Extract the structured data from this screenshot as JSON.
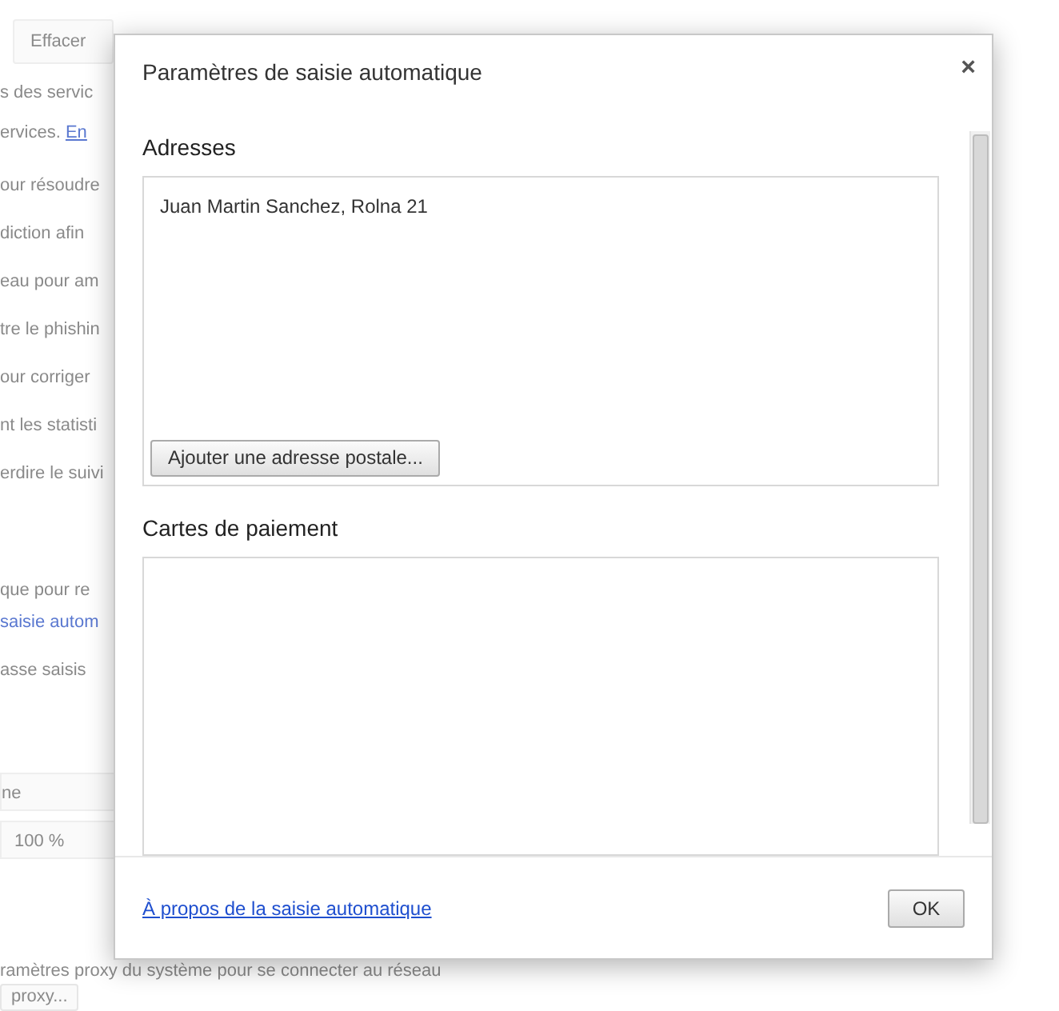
{
  "background": {
    "clear_button": "Effacer",
    "lines": [
      {
        "kind": "text",
        "text": "s des servic"
      },
      {
        "kind": "mixed",
        "text": "ervices. ",
        "link": "En"
      },
      {
        "kind": "text",
        "text": "our résoudre"
      },
      {
        "kind": "text",
        "text": "diction afin"
      },
      {
        "kind": "text",
        "text": "eau pour am"
      },
      {
        "kind": "text",
        "text": "tre le phishin"
      },
      {
        "kind": "text",
        "text": "our corriger"
      },
      {
        "kind": "text",
        "text": "nt les statisti"
      },
      {
        "kind": "text",
        "text": "erdire le suivi"
      }
    ],
    "autofill_lines": [
      {
        "kind": "text",
        "text": "que pour re"
      },
      {
        "kind": "link",
        "text": "saisie autom"
      }
    ],
    "password_line": "asse saisis",
    "dropdowns": [
      "ne",
      "100 %"
    ],
    "proxy_text": "ramètres proxy du système pour se connecter au réseau",
    "proxy_button": "proxy..."
  },
  "dialog": {
    "title": "Paramètres de saisie automatique",
    "close": "×",
    "addresses": {
      "heading": "Adresses",
      "entries": [
        "Juan  Martin Sanchez, Rolna 21"
      ],
      "add_button": "Ajouter une adresse postale..."
    },
    "cards": {
      "heading": "Cartes de paiement"
    },
    "footer_link": "À propos de la saisie automatique",
    "ok_button": "OK"
  }
}
